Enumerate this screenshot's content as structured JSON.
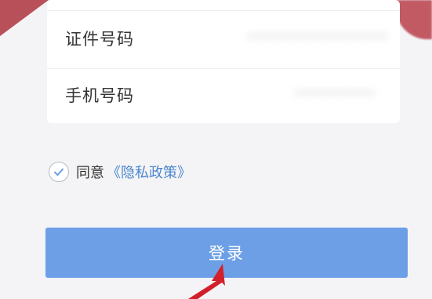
{
  "colors": {
    "accent": "#6d9fe6",
    "link": "#4c86cc",
    "overlay_red": "#d2202a"
  },
  "form": {
    "fields": [
      {
        "label": "证件号码",
        "value": "•••••••••••••••••••"
      },
      {
        "label": "手机号码",
        "value": "•••••••••••"
      }
    ]
  },
  "agreement": {
    "checked": true,
    "prefix": "同意",
    "link_text": "《隐私政策》"
  },
  "login_button": {
    "label": "登录"
  },
  "icons": {
    "checkbox": "check-circle-icon",
    "arrow": "red-arrow-icon"
  }
}
